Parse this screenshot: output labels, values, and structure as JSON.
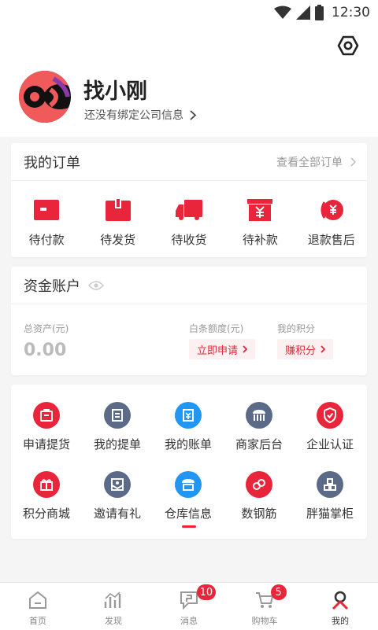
{
  "status_bar": {
    "time": "12:30"
  },
  "profile": {
    "name": "找小刚",
    "company_prompt": "还没有绑定公司信息"
  },
  "orders": {
    "title": "我的订单",
    "view_all": "查看全部订单",
    "items": [
      {
        "label": "待付款",
        "icon": "wallet-icon"
      },
      {
        "label": "待发货",
        "icon": "package-icon"
      },
      {
        "label": "待收货",
        "icon": "truck-icon"
      },
      {
        "label": "待补款",
        "icon": "yuan-box-icon"
      },
      {
        "label": "退款售后",
        "icon": "refund-icon"
      }
    ]
  },
  "account": {
    "title": "资金账户",
    "total_assets_label": "总资产(元)",
    "total_assets_value": "0.00",
    "credit_label": "白条额度(元)",
    "credit_action": "立即申请",
    "points_label": "我的积分",
    "points_action": "赚积分"
  },
  "services": {
    "items": [
      {
        "label": "申请提货",
        "icon": "pickup-icon",
        "color": "#e8253a"
      },
      {
        "label": "我的提单",
        "icon": "document-icon",
        "color": "#5b6a86"
      },
      {
        "label": "我的账单",
        "icon": "bill-icon",
        "color": "#2196f3"
      },
      {
        "label": "商家后台",
        "icon": "store-icon",
        "color": "#5b6a86"
      },
      {
        "label": "企业认证",
        "icon": "shield-icon",
        "color": "#e8253a"
      },
      {
        "label": "积分商城",
        "icon": "gift-icon",
        "color": "#e8253a"
      },
      {
        "label": "邀请有礼",
        "icon": "invite-icon",
        "color": "#5b6a86"
      },
      {
        "label": "仓库信息",
        "icon": "warehouse-icon",
        "color": "#2196f3"
      },
      {
        "label": "数钢筋",
        "icon": "rebar-icon",
        "color": "#e8253a"
      },
      {
        "label": "胖猫掌柜",
        "icon": "cabinet-icon",
        "color": "#5b6a86"
      }
    ]
  },
  "tabbar": {
    "items": [
      {
        "label": "首页",
        "icon": "home-icon",
        "badge": ""
      },
      {
        "label": "发现",
        "icon": "discover-icon",
        "badge": ""
      },
      {
        "label": "消息",
        "icon": "message-icon",
        "badge": "10"
      },
      {
        "label": "购物车",
        "icon": "cart-icon",
        "badge": "5"
      },
      {
        "label": "我的",
        "icon": "profile-icon",
        "badge": ""
      }
    ]
  },
  "colors": {
    "accent": "#e8253a",
    "slate": "#5b6a86",
    "blue": "#2196f3"
  }
}
